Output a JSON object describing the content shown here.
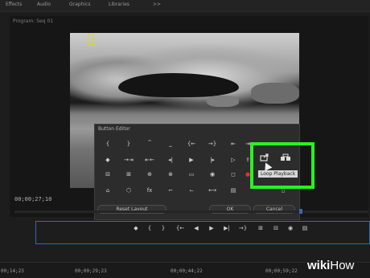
{
  "workspace_tabs": [
    "Effects",
    "Audio",
    "Graphics",
    "Libraries",
    ">>"
  ],
  "monitor": {
    "title": "Program: Seq 01",
    "timecode": "00;00;27;10"
  },
  "button_editor": {
    "title": "Button Editor",
    "reset_layout_label": "Reset Layout",
    "ok_label": "OK",
    "cancel_label": "Cancel",
    "tooltip": "Loop Playback",
    "grid_icons": [
      [
        "{",
        "}",
        "⎴",
        "⎵",
        "{←",
        "→}",
        "⇤",
        "⇥"
      ],
      [
        "◆",
        "→⇥",
        "⇤←",
        "◂|",
        "▶",
        "|▸",
        "▷",
        "⇪"
      ],
      [
        "⊟",
        "⊞",
        "⊕",
        "⊗",
        "▭",
        "◉",
        "◻",
        "●"
      ],
      [
        "⌂",
        "⬡",
        "fx",
        "⌐",
        "⌙",
        "⟷",
        "▤",
        "▯"
      ]
    ]
  },
  "playback_bar": {
    "icons": [
      "◆",
      "{",
      "}",
      "{←",
      "◀",
      "▶",
      "▶|",
      "→}",
      "⊞",
      "⊟",
      "◉",
      "▤"
    ]
  },
  "ruler": {
    "timecodes": [
      "00;14;23",
      "00;00;29;23",
      "00;00;44;22",
      "00;00;59;22"
    ]
  },
  "watermark": {
    "part1": "wiki",
    "part2": "How"
  },
  "colors": {
    "highlight": "#2cf121",
    "playbar_border": "#3569b2",
    "marker": "#e5d22a"
  }
}
